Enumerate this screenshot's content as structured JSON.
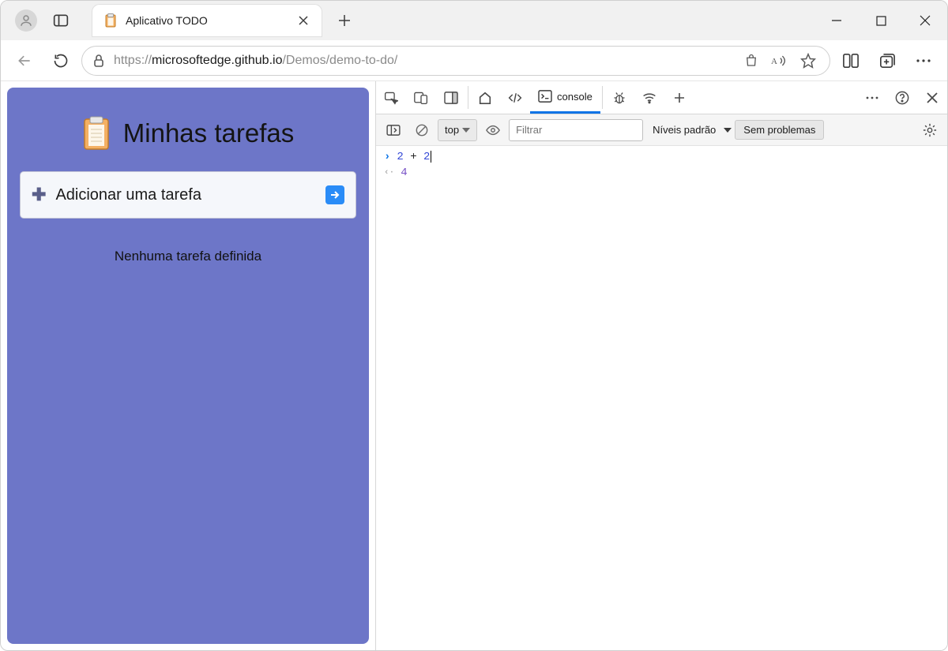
{
  "browser": {
    "tab_title": "Aplicativo TODO",
    "url_secure_prefix": "https://",
    "url_host": "microsoftedge.github.io",
    "url_path": "/Demos/demo-to-do/"
  },
  "app": {
    "heading": "Minhas tarefas",
    "add_task_label": "Adicionar uma tarefa",
    "empty_state": "Nenhuma tarefa definida"
  },
  "devtools": {
    "active_tab_label": "console",
    "context_label": "top",
    "filter_placeholder": "Filtrar",
    "levels_label": "Níveis padrão",
    "issues_label": "Sem problemas",
    "input_expression_tokens": [
      "2",
      "+",
      "2"
    ],
    "output_value": "4"
  }
}
